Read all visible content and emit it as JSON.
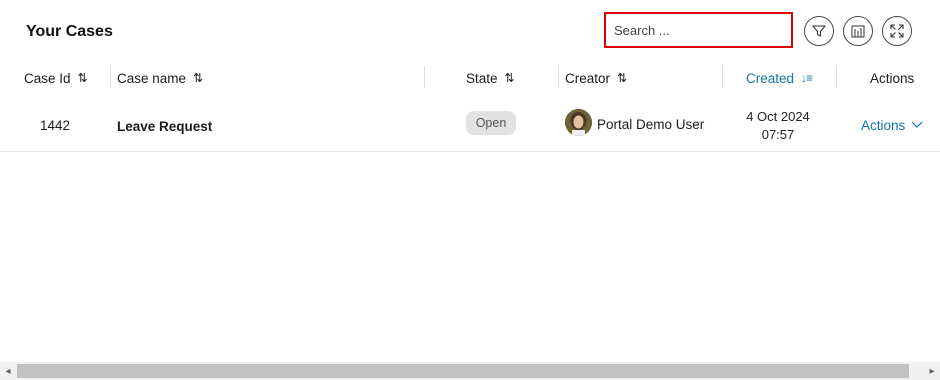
{
  "title": "Your Cases",
  "search": {
    "placeholder": "Search ..."
  },
  "toolbar": {
    "filter_icon": "filter-icon",
    "columns_icon": "column-settings-icon",
    "expand_icon": "fullscreen-expand-icon"
  },
  "columns": {
    "case_id": "Case Id",
    "case_name": "Case name",
    "state": "State",
    "creator": "Creator",
    "created": "Created",
    "actions": "Actions"
  },
  "sort_icons": {
    "default": "⇅",
    "active": "↓≡"
  },
  "rows": [
    {
      "id": "1442",
      "name": "Leave Request",
      "state": "Open",
      "creator": "Portal Demo User",
      "created_date": "4 Oct 2024",
      "created_time": "07:57",
      "actions": "Actions"
    }
  ],
  "colors": {
    "accent": "#1177aa",
    "highlight": "#e00000",
    "badge_bg": "#e2e2e2"
  }
}
